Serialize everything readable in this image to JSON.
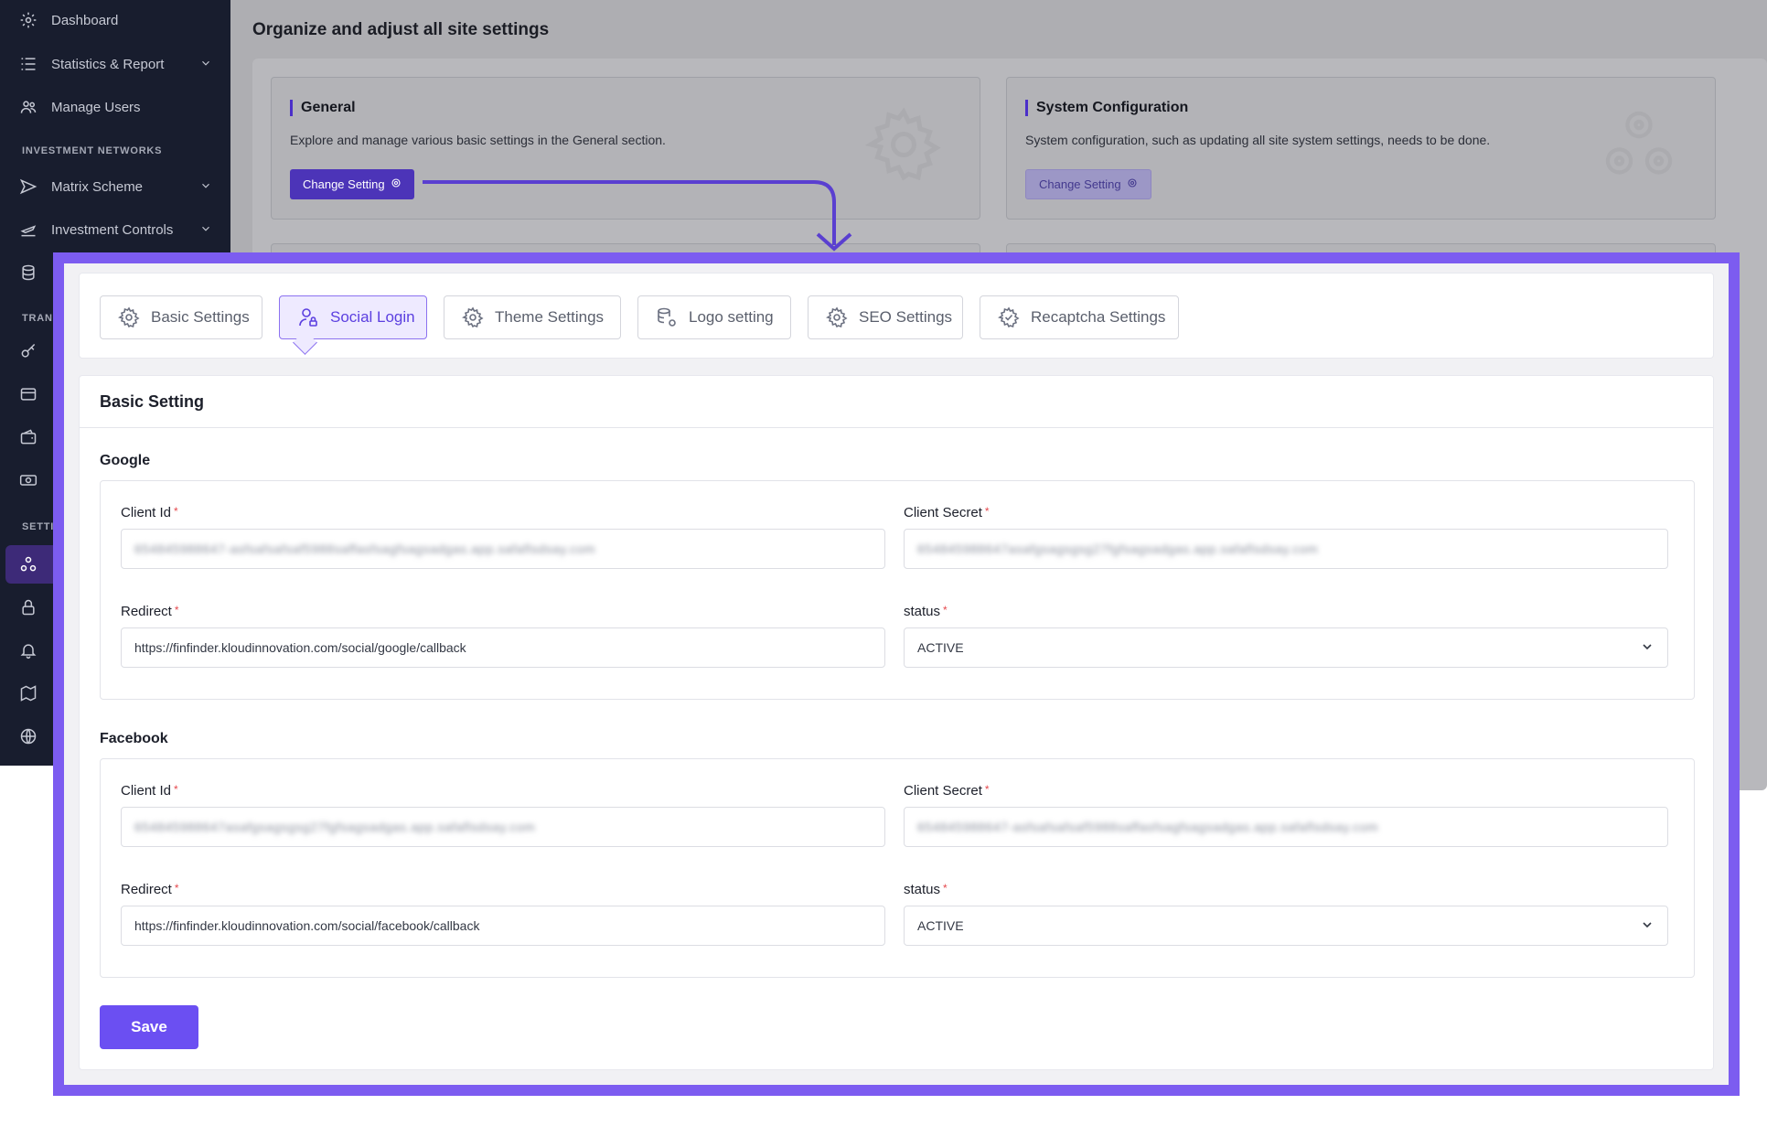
{
  "sidebar": {
    "items": [
      {
        "label": "Dashboard",
        "icon": "gear-icon"
      },
      {
        "label": "Statistics & Report",
        "icon": "list-icon"
      },
      {
        "label": "Manage Users",
        "icon": "users-icon"
      }
    ],
    "section_investment": "INVESTMENT NETWORKS",
    "investment_items": [
      {
        "label": "Matrix Scheme",
        "icon": "send-icon"
      },
      {
        "label": "Investment Controls",
        "icon": "plane-icon"
      }
    ],
    "section_trans": "TRANS",
    "section_setti": "SETTI"
  },
  "background": {
    "heading": "Organize and adjust all site settings",
    "cards": [
      {
        "title": "General",
        "description": "Explore and manage various basic settings in the General section.",
        "button": "Change Setting"
      },
      {
        "title": "System Configuration",
        "description": "System configuration, such as updating all site system settings, needs to be done.",
        "button": "Change Setting"
      }
    ]
  },
  "tabs": [
    {
      "label": "Basic Settings",
      "icon": "gear-icon"
    },
    {
      "label": "Social Login",
      "icon": "user-lock-icon"
    },
    {
      "label": "Theme Settings",
      "icon": "gear-icon"
    },
    {
      "label": "Logo setting",
      "icon": "database-gear-icon"
    },
    {
      "label": "SEO Settings",
      "icon": "gear-icon"
    },
    {
      "label": "Recaptcha Settings",
      "icon": "gear-check-icon"
    }
  ],
  "form": {
    "title": "Basic Setting",
    "required_mark": "*",
    "groups": [
      {
        "name": "Google",
        "client_id_label": "Client Id",
        "client_id_value": "654845988647-asfsafsafsaf5988saffasfsagfsagsadgas.app.safaflsdsay.com",
        "client_secret_label": "Client Secret",
        "client_secret_value": "654845988647asafgsagsgsg27fgfsagsadgas.app.safaflsdsay.com",
        "redirect_label": "Redirect",
        "redirect_value": "https://finfinder.kloudinnovation.com/social/google/callback",
        "status_label": "status",
        "status_value": "ACTIVE"
      },
      {
        "name": "Facebook",
        "client_id_label": "Client Id",
        "client_id_value": "654845988647asafgsagsgsg27fgfsagsadgas.app.safaflsdsay.com",
        "client_secret_label": "Client Secret",
        "client_secret_value": "654845988647-asfsafsafsaf5988saffasfsagfsagsadgas.app.safaflsdsay.com",
        "redirect_label": "Redirect",
        "redirect_value": "https://finfinder.kloudinnovation.com/social/facebook/callback",
        "status_label": "status",
        "status_value": "ACTIVE"
      }
    ],
    "save_label": "Save"
  },
  "colors": {
    "accent": "#6b4ff2",
    "highlight_border": "#7c5cf0",
    "sidebar_bg": "#181d2e",
    "required": "#e5484d"
  }
}
